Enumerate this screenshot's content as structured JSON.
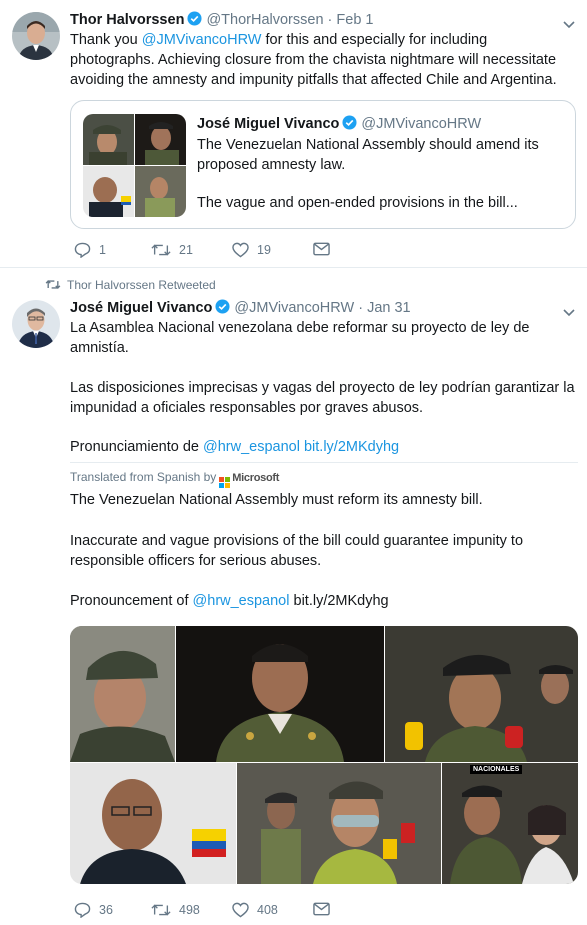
{
  "tweets": [
    {
      "author_name": "Thor Halvorssen",
      "handle": "@ThorHalvorssen",
      "date": "Feb 1",
      "text_prefix": "Thank you ",
      "mention": "@JMVivancoHRW",
      "text_suffix": " for this and especially for including photographs. Achieving closure from the chavista nightmare will necessitate avoiding the amnesty and impunity pitfalls that affected Chile and Argentina.",
      "quote": {
        "author_name": "José Miguel Vivanco",
        "handle": "@JMVivancoHRW",
        "line1": "The Venezuelan National Assembly should amend its proposed amnesty law.",
        "line2": "The vague and open-ended provisions in the bill..."
      },
      "actions": {
        "replies": "1",
        "retweets": "21",
        "likes": "19"
      }
    },
    {
      "retweeted_by": "Thor Halvorssen Retweeted",
      "author_name": "José Miguel Vivanco",
      "handle": "@JMVivancoHRW",
      "date": "Jan 31",
      "original": {
        "p1": "La Asamblea Nacional venezolana debe reformar su proyecto de ley de amnistía.",
        "p2": "Las disposiciones imprecisas y vagas del proyecto de ley podrían garantizar la impunidad a oficiales responsables por graves abusos.",
        "p3_prefix": "Pronunciamiento de ",
        "p3_mention": "@hrw_espanol",
        "p3_link": "bit.ly/2MKdyhg"
      },
      "translated_label": "Translated from Spanish by",
      "translator": "Microsoft",
      "translation": {
        "p1": "The Venezuelan National Assembly must reform its amnesty bill.",
        "p2": "Inaccurate and vague provisions of the bill could guarantee impunity to responsible officers for serious abuses.",
        "p3_prefix": "Pronouncement of ",
        "p3_mention": "@hrw_espanol",
        "p3_link": "bit.ly/2MKdyhg"
      },
      "photo_badge": "NACIONALES",
      "actions": {
        "replies": "36",
        "retweets": "498",
        "likes": "408"
      }
    }
  ],
  "colors": {
    "link": "#1b95e0",
    "verified": "#1da1f2",
    "muted": "#657786",
    "border": "#e6ecf0"
  },
  "icons": [
    "reply-icon",
    "retweet-icon",
    "like-icon",
    "dm-icon",
    "verified-icon",
    "chevron-down-icon",
    "microsoft-logo"
  ]
}
